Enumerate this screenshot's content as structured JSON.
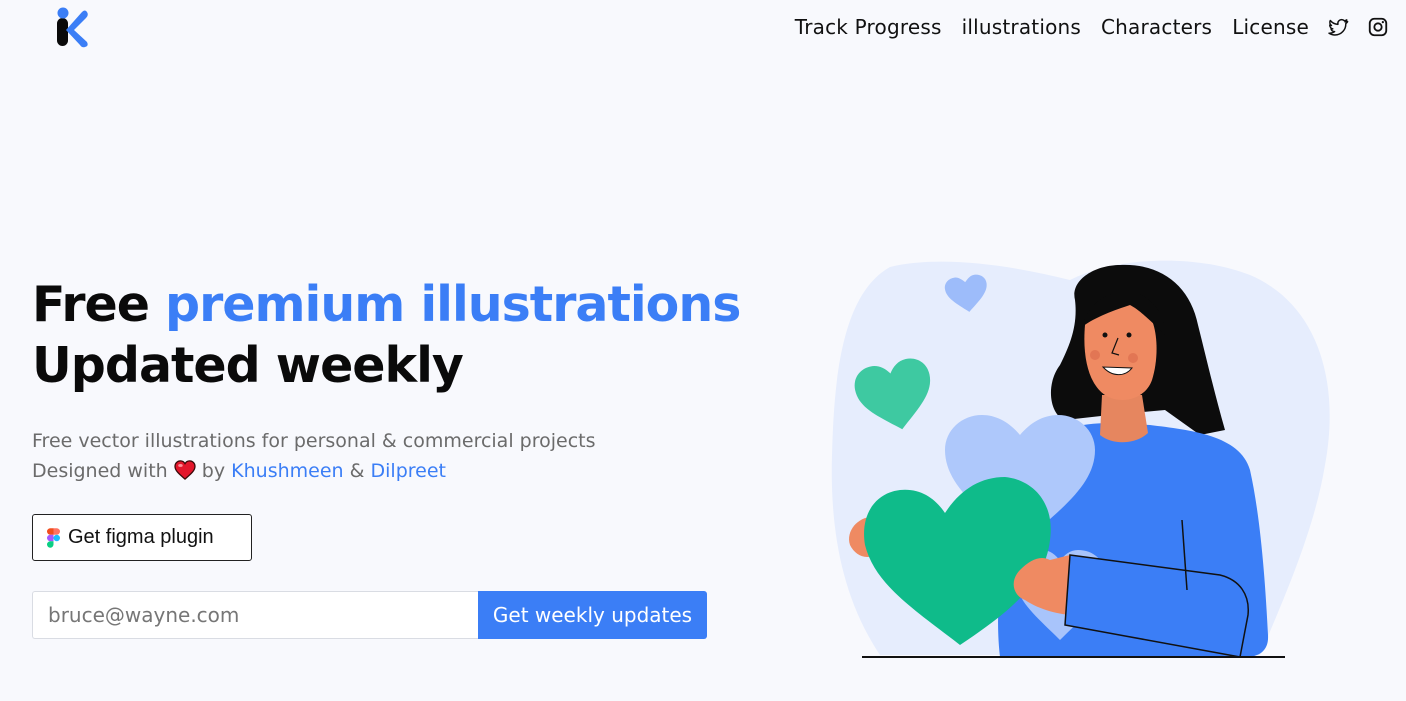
{
  "brand": {
    "logo_icon": "k-logo-icon",
    "colors": {
      "blue": "#3b7ef6",
      "black": "#0a0a0a"
    }
  },
  "nav": {
    "items": [
      "Track Progress",
      "illustrations",
      "Characters",
      "License"
    ],
    "social": [
      "twitter-icon",
      "instagram-icon"
    ]
  },
  "hero": {
    "title_part1": "Free ",
    "title_accent": "premium illustrations",
    "title_line2": "Updated weekly",
    "subtitle": "Free vector illustrations for personal & commercial projects",
    "designed_prefix": "Designed with",
    "designed_by": "by",
    "author1": "Khushmeen",
    "amp": "&",
    "author2": "Dilpreet"
  },
  "figma_button": {
    "label": "Get figma plugin",
    "icon": "figma-icon"
  },
  "subscribe": {
    "placeholder": "bruce@wayne.com",
    "button_label": "Get weekly updates"
  },
  "illustration": {
    "name": "woman-holding-heart",
    "accent": "#0fbb8a",
    "light_blue": "#aec8fb"
  }
}
